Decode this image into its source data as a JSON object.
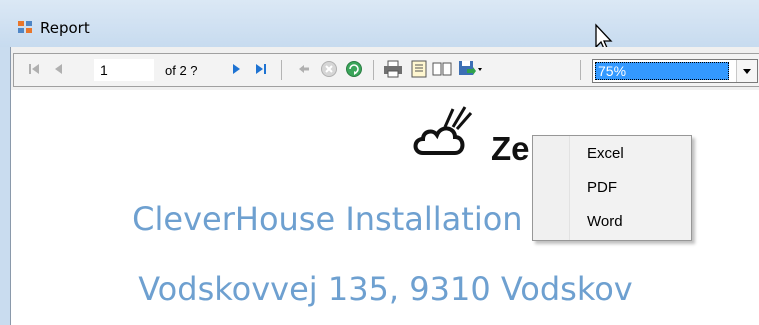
{
  "window": {
    "title": "Report"
  },
  "toolbar": {
    "page_current": "1",
    "page_total_label": "of 2 ?",
    "zoom_value": "75%",
    "buttons": [
      "first-page-icon",
      "previous-page-icon",
      "next-page-icon",
      "last-page-icon",
      "back-icon",
      "stop-icon",
      "refresh-icon",
      "print-icon",
      "print-layout-icon",
      "page-setup-icon",
      "export-icon"
    ]
  },
  "export_menu": {
    "items": [
      "Excel",
      "PDF",
      "Word"
    ]
  },
  "document": {
    "logo_text": "Ze      tific",
    "title": "CleverHouse Installation Report",
    "address": "Vodskovvej 135, 9310 Vodskov"
  },
  "colors": {
    "heading": "#6ea0d0",
    "zoom_highlight": "#3399ff",
    "titlebar": "#c9dcef"
  }
}
